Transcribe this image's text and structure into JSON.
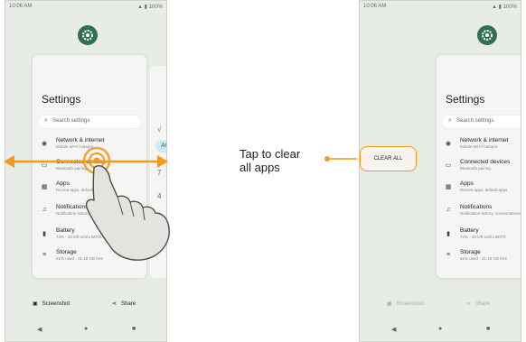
{
  "status": {
    "time": "10:06 AM",
    "battery": "100%"
  },
  "settings": {
    "title": "Settings",
    "search_placeholder": "Search settings",
    "items": [
      {
        "icon": "wifi-icon",
        "glyph": "◉",
        "title": "Network & internet",
        "subtitle": "Mobile Wi-Fi hotspot"
      },
      {
        "icon": "connected-devices-icon",
        "glyph": "▭",
        "title": "Connected devices",
        "subtitle": "Bluetooth pairing"
      },
      {
        "icon": "apps-icon",
        "glyph": "▦",
        "title": "Apps",
        "subtitle": "Recent apps, default apps"
      },
      {
        "icon": "bell-icon",
        "glyph": "♫",
        "title": "Notifications",
        "subtitle": "Notification history, conversations"
      },
      {
        "icon": "battery-icon",
        "glyph": "▮",
        "title": "Battery",
        "subtitle": "73% - 4h left until LIMITS"
      },
      {
        "icon": "storage-icon",
        "glyph": "≡",
        "title": "Storage",
        "subtitle": "51% used - 31.18 GB free"
      }
    ]
  },
  "peek_chars": [
    "√",
    "AC",
    "7",
    "4",
    "1",
    "0"
  ],
  "actions": {
    "screenshot": "Screenshot",
    "share": "Share"
  },
  "clear_all": "CLEAR ALL",
  "callout": {
    "line1": "Tap to clear",
    "line2": "all apps"
  },
  "colors": {
    "accent": "#f39a1e",
    "settings_icon": "#2f6f52"
  }
}
